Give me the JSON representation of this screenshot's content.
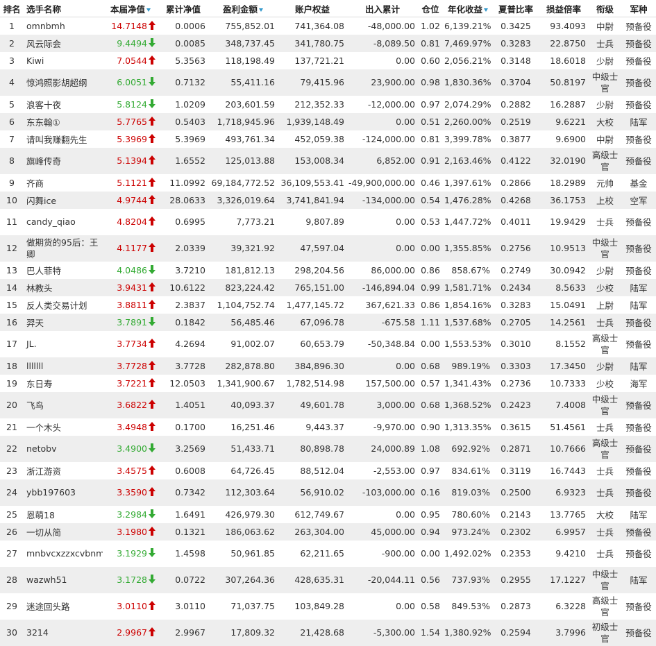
{
  "headers": {
    "rank": "排名",
    "name": "选手名称",
    "nav": "本届净值",
    "cum_nav": "累计净值",
    "profit": "盈利金额",
    "equity": "账户权益",
    "inout": "出入累计",
    "position": "仓位",
    "annual": "年化收益",
    "sharpe": "夏普比率",
    "pl_ratio": "损益倍率",
    "title": "衔级",
    "branch": "军种"
  },
  "colors": {
    "up": "#cc0000",
    "down": "#33aa33",
    "sort": "#3399cc",
    "row_alt": "#eeeeee"
  },
  "rows": [
    {
      "rank": "1",
      "name": "omnbmh",
      "nav": "14.7148",
      "dir": "up",
      "cum": "0.0006",
      "profit": "755,852.01",
      "equity": "741,364.08",
      "inout": "-48,000.00",
      "pos": "1.02",
      "annual": "6,139.21%",
      "sharpe": "0.3425",
      "pl": "93.4093",
      "title": "中尉",
      "branch": "预备役"
    },
    {
      "rank": "2",
      "name": "风云际会",
      "nav": "9.4494",
      "dir": "down",
      "cum": "0.0085",
      "profit": "348,737.45",
      "equity": "341,780.75",
      "inout": "-8,089.50",
      "pos": "0.81",
      "annual": "7,469.97%",
      "sharpe": "0.3283",
      "pl": "22.8750",
      "title": "士兵",
      "branch": "预备役"
    },
    {
      "rank": "3",
      "name": "Kiwi",
      "nav": "7.0544",
      "dir": "up",
      "cum": "5.3563",
      "profit": "118,198.49",
      "equity": "137,721.21",
      "inout": "0.00",
      "pos": "0.60",
      "annual": "2,056.21%",
      "sharpe": "0.3148",
      "pl": "18.6018",
      "title": "少尉",
      "branch": "预备役"
    },
    {
      "rank": "4",
      "name": "惊鸿照影胡超纲",
      "nav": "6.0051",
      "dir": "down",
      "cum": "0.7132",
      "profit": "55,411.16",
      "equity": "79,415.96",
      "inout": "23,900.00",
      "pos": "0.98",
      "annual": "1,830.36%",
      "sharpe": "0.3704",
      "pl": "50.8197",
      "title": "中级士官",
      "branch": "预备役"
    },
    {
      "rank": "5",
      "name": "浪客十夜",
      "nav": "5.8124",
      "dir": "down",
      "cum": "1.0209",
      "profit": "203,601.59",
      "equity": "212,352.33",
      "inout": "-12,000.00",
      "pos": "0.97",
      "annual": "2,074.29%",
      "sharpe": "0.2882",
      "pl": "16.2887",
      "title": "少尉",
      "branch": "预备役"
    },
    {
      "rank": "6",
      "name": "东东翰①",
      "nav": "5.7765",
      "dir": "up",
      "cum": "0.5403",
      "profit": "1,718,945.96",
      "equity": "1,939,148.49",
      "inout": "0.00",
      "pos": "0.51",
      "annual": "2,260.00%",
      "sharpe": "0.2519",
      "pl": "9.6221",
      "title": "大校",
      "branch": "陆军"
    },
    {
      "rank": "7",
      "name": "请叫我赚翻先生",
      "nav": "5.3969",
      "dir": "up",
      "cum": "5.3969",
      "profit": "493,761.34",
      "equity": "452,059.38",
      "inout": "-124,000.00",
      "pos": "0.81",
      "annual": "3,399.78%",
      "sharpe": "0.3877",
      "pl": "9.6900",
      "title": "中尉",
      "branch": "预备役"
    },
    {
      "rank": "8",
      "name": "旗峰传奇",
      "nav": "5.1394",
      "dir": "up",
      "cum": "1.6552",
      "profit": "125,013.88",
      "equity": "153,008.34",
      "inout": "6,852.00",
      "pos": "0.91",
      "annual": "2,163.46%",
      "sharpe": "0.4122",
      "pl": "32.0190",
      "title": "高级士官",
      "branch": "预备役"
    },
    {
      "rank": "9",
      "name": "齐商",
      "nav": "5.1121",
      "dir": "up",
      "cum": "11.0992",
      "profit": "69,184,772.52",
      "equity": "36,109,553.41",
      "inout": "-49,900,000.00",
      "pos": "0.46",
      "annual": "1,397.61%",
      "sharpe": "0.2866",
      "pl": "18.2989",
      "title": "元帅",
      "branch": "基金"
    },
    {
      "rank": "10",
      "name": "闪舞ice",
      "nav": "4.9744",
      "dir": "up",
      "cum": "28.0633",
      "profit": "3,326,019.64",
      "equity": "3,741,841.94",
      "inout": "-134,000.00",
      "pos": "0.54",
      "annual": "1,476.28%",
      "sharpe": "0.4268",
      "pl": "36.1753",
      "title": "上校",
      "branch": "空军"
    },
    {
      "rank": "11",
      "name": "candy_qiao",
      "nav": "4.8204",
      "dir": "up",
      "cum": "0.6995",
      "profit": "7,773.21",
      "equity": "9,807.89",
      "inout": "0.00",
      "pos": "0.53",
      "annual": "1,447.72%",
      "sharpe": "0.4011",
      "pl": "19.9429",
      "title": "士兵",
      "branch": "预备役"
    },
    {
      "rank": "12",
      "name": "做期货的95后：王卿",
      "nav": "4.1177",
      "dir": "up",
      "cum": "2.0339",
      "profit": "39,321.92",
      "equity": "47,597.04",
      "inout": "0.00",
      "pos": "0.00",
      "annual": "1,355.85%",
      "sharpe": "0.2756",
      "pl": "10.9513",
      "title": "中级士官",
      "branch": "预备役"
    },
    {
      "rank": "13",
      "name": "巴人菲特",
      "nav": "4.0486",
      "dir": "down",
      "cum": "3.7210",
      "profit": "181,812.13",
      "equity": "298,204.56",
      "inout": "86,000.00",
      "pos": "0.86",
      "annual": "858.67%",
      "sharpe": "0.2749",
      "pl": "30.0942",
      "title": "少尉",
      "branch": "预备役"
    },
    {
      "rank": "14",
      "name": "林教头",
      "nav": "3.9431",
      "dir": "up",
      "cum": "10.6122",
      "profit": "823,224.42",
      "equity": "765,151.00",
      "inout": "-146,894.04",
      "pos": "0.99",
      "annual": "1,581.71%",
      "sharpe": "0.2434",
      "pl": "8.5633",
      "title": "少校",
      "branch": "陆军"
    },
    {
      "rank": "15",
      "name": "反人类交易计划",
      "nav": "3.8811",
      "dir": "up",
      "cum": "2.3837",
      "profit": "1,104,752.74",
      "equity": "1,477,145.72",
      "inout": "367,621.33",
      "pos": "0.86",
      "annual": "1,854.16%",
      "sharpe": "0.3283",
      "pl": "15.0491",
      "title": "上尉",
      "branch": "陆军"
    },
    {
      "rank": "16",
      "name": "羿天",
      "nav": "3.7891",
      "dir": "down",
      "cum": "0.1842",
      "profit": "56,485.46",
      "equity": "67,096.78",
      "inout": "-675.58",
      "pos": "1.11",
      "annual": "1,537.68%",
      "sharpe": "0.2705",
      "pl": "14.2561",
      "title": "士兵",
      "branch": "预备役"
    },
    {
      "rank": "17",
      "name": "JL.",
      "nav": "3.7734",
      "dir": "up",
      "cum": "4.2694",
      "profit": "91,002.07",
      "equity": "60,653.79",
      "inout": "-50,348.84",
      "pos": "0.00",
      "annual": "1,553.53%",
      "sharpe": "0.3010",
      "pl": "8.1552",
      "title": "高级士官",
      "branch": "预备役"
    },
    {
      "rank": "18",
      "name": "lllllll",
      "nav": "3.7728",
      "dir": "up",
      "cum": "3.7728",
      "profit": "282,878.80",
      "equity": "384,896.30",
      "inout": "0.00",
      "pos": "0.68",
      "annual": "989.19%",
      "sharpe": "0.3303",
      "pl": "17.3450",
      "title": "少尉",
      "branch": "陆军"
    },
    {
      "rank": "19",
      "name": "东日寿",
      "nav": "3.7221",
      "dir": "up",
      "cum": "12.0503",
      "profit": "1,341,900.67",
      "equity": "1,782,514.98",
      "inout": "157,500.00",
      "pos": "0.57",
      "annual": "1,341.43%",
      "sharpe": "0.2736",
      "pl": "10.7333",
      "title": "少校",
      "branch": "海军"
    },
    {
      "rank": "20",
      "name": "飞鸟",
      "nav": "3.6822",
      "dir": "up",
      "cum": "1.4051",
      "profit": "40,093.37",
      "equity": "49,601.78",
      "inout": "3,000.00",
      "pos": "0.68",
      "annual": "1,368.52%",
      "sharpe": "0.2423",
      "pl": "7.4008",
      "title": "中级士官",
      "branch": "预备役"
    },
    {
      "rank": "21",
      "name": "一个木头",
      "nav": "3.4948",
      "dir": "up",
      "cum": "0.1700",
      "profit": "16,251.46",
      "equity": "9,443.37",
      "inout": "-9,970.00",
      "pos": "0.90",
      "annual": "1,313.35%",
      "sharpe": "0.3615",
      "pl": "51.4561",
      "title": "士兵",
      "branch": "预备役"
    },
    {
      "rank": "22",
      "name": "netobv",
      "nav": "3.4900",
      "dir": "down",
      "cum": "3.2569",
      "profit": "51,433.71",
      "equity": "80,898.78",
      "inout": "24,000.89",
      "pos": "1.08",
      "annual": "692.92%",
      "sharpe": "0.2871",
      "pl": "10.7666",
      "title": "高级士官",
      "branch": "预备役"
    },
    {
      "rank": "23",
      "name": "浙江游资",
      "nav": "3.4575",
      "dir": "up",
      "cum": "0.6008",
      "profit": "64,726.45",
      "equity": "88,512.04",
      "inout": "-2,553.00",
      "pos": "0.97",
      "annual": "834.61%",
      "sharpe": "0.3119",
      "pl": "16.7443",
      "title": "士兵",
      "branch": "预备役"
    },
    {
      "rank": "24",
      "name": "ybb197603",
      "nav": "3.3590",
      "dir": "up",
      "cum": "0.7342",
      "profit": "112,303.64",
      "equity": "56,910.02",
      "inout": "-103,000.00",
      "pos": "0.16",
      "annual": "819.03%",
      "sharpe": "0.2500",
      "pl": "6.9323",
      "title": "士兵",
      "branch": "预备役"
    },
    {
      "rank": "25",
      "name": "恩萌18",
      "nav": "3.2984",
      "dir": "down",
      "cum": "1.6491",
      "profit": "426,979.30",
      "equity": "612,749.67",
      "inout": "0.00",
      "pos": "0.95",
      "annual": "780.60%",
      "sharpe": "0.2143",
      "pl": "13.7765",
      "title": "大校",
      "branch": "陆军"
    },
    {
      "rank": "26",
      "name": "一切从简",
      "nav": "3.1980",
      "dir": "up",
      "cum": "0.1321",
      "profit": "186,063.62",
      "equity": "263,304.00",
      "inout": "45,000.00",
      "pos": "0.94",
      "annual": "973.24%",
      "sharpe": "0.2302",
      "pl": "6.9957",
      "title": "士兵",
      "branch": "预备役"
    },
    {
      "rank": "27",
      "name": "mnbvcxzzxcvbnm",
      "nav": "3.1929",
      "dir": "down",
      "cum": "1.4598",
      "profit": "50,961.85",
      "equity": "62,211.65",
      "inout": "-900.00",
      "pos": "0.00",
      "annual": "1,492.02%",
      "sharpe": "0.2353",
      "pl": "9.4210",
      "title": "士兵",
      "branch": "预备役"
    },
    {
      "rank": "28",
      "name": "wazwh51",
      "nav": "3.1728",
      "dir": "down",
      "cum": "0.0722",
      "profit": "307,264.36",
      "equity": "428,635.31",
      "inout": "-20,044.11",
      "pos": "0.56",
      "annual": "737.93%",
      "sharpe": "0.2955",
      "pl": "17.1227",
      "title": "中级士官",
      "branch": "陆军"
    },
    {
      "rank": "29",
      "name": "迷途回头路",
      "nav": "3.0110",
      "dir": "up",
      "cum": "3.0110",
      "profit": "71,037.75",
      "equity": "103,849.28",
      "inout": "0.00",
      "pos": "0.58",
      "annual": "849.53%",
      "sharpe": "0.2873",
      "pl": "6.3228",
      "title": "高级士官",
      "branch": "预备役"
    },
    {
      "rank": "30",
      "name": "3214",
      "nav": "2.9967",
      "dir": "up",
      "cum": "2.9967",
      "profit": "17,809.32",
      "equity": "21,428.68",
      "inout": "-5,300.00",
      "pos": "1.54",
      "annual": "1,380.92%",
      "sharpe": "0.2594",
      "pl": "3.7996",
      "title": "初级士官",
      "branch": "预备役"
    }
  ]
}
